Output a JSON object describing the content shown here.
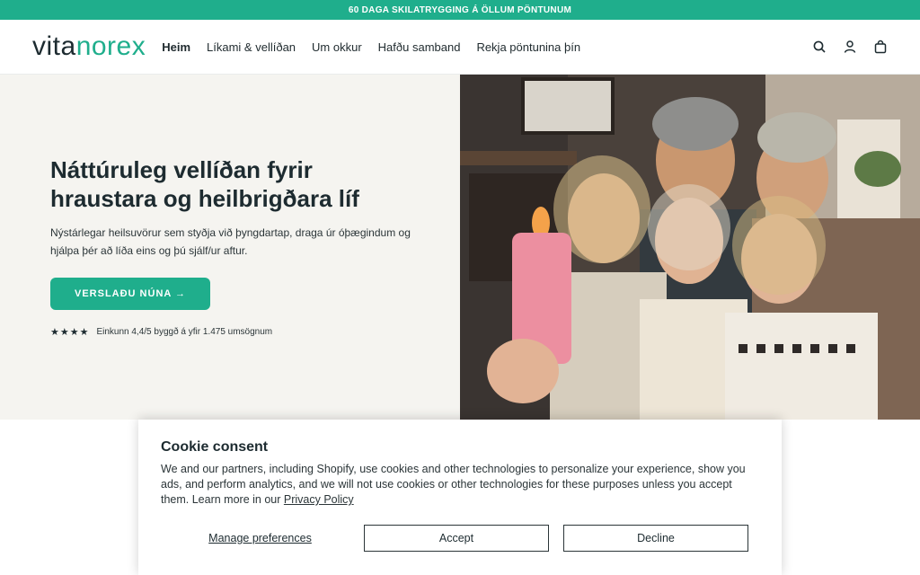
{
  "announcement": "60 DAGA SKILATRYGGING Á ÖLLUM PÖNTUNUM",
  "logo": {
    "part1": "vita",
    "part2": "norex"
  },
  "nav": [
    {
      "label": "Heim"
    },
    {
      "label": "Líkami & vellíðan"
    },
    {
      "label": "Um okkur"
    },
    {
      "label": "Hafðu samband"
    },
    {
      "label": "Rekja pöntunina þín"
    }
  ],
  "header_icons": [
    "search-icon",
    "account-icon",
    "cart-icon"
  ],
  "hero": {
    "title": "Náttúruleg vellíðan fyrir hraustara og heilbrigðara líf",
    "subtitle": "Nýstárlegar heilsuvörur sem styðja við þyngdartap, draga úr óþægindum og hjálpa þér að líða eins og þú sjálf/ur aftur.",
    "cta": "VERSLAÐU NÚNA →",
    "stars": "★★★★",
    "rating_text": "Einkunn 4,4/5 byggð á yfir 1.475 umsögnum"
  },
  "cookie": {
    "title": "Cookie consent",
    "body": "We and our partners, including Shopify, use cookies and other technologies to personalize your experience, show you ads, and perform analytics, and we will not use cookies or other technologies for these purposes unless you accept them. Learn more in our ",
    "link": "Privacy Policy",
    "manage": "Manage preferences",
    "accept": "Accept",
    "decline": "Decline"
  },
  "colors": {
    "accent": "#1fae8c",
    "text": "#1d2b30",
    "hero_bg": "#f5f4f0"
  }
}
